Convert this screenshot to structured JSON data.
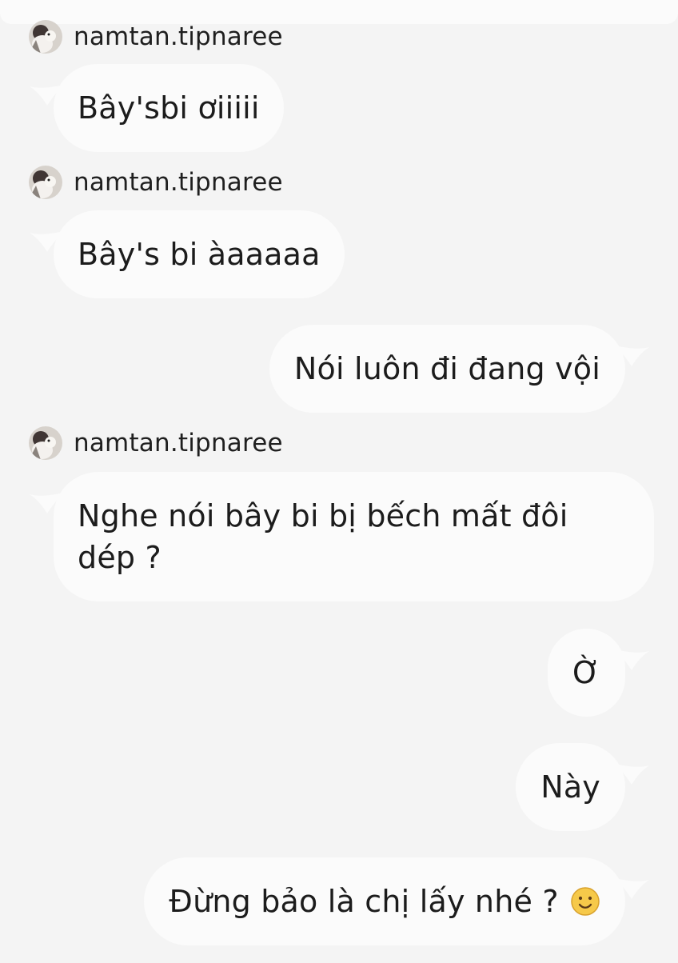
{
  "conversation": {
    "messages": [
      {
        "side": "left",
        "sender": "namtan.tipnaree",
        "text": "Bây'sbi ơiiiii"
      },
      {
        "side": "left",
        "sender": "namtan.tipnaree",
        "text": "Bây's bi àaaaaa"
      },
      {
        "side": "right",
        "text": "Nói luôn đi đang vội"
      },
      {
        "side": "left",
        "sender": "namtan.tipnaree",
        "text": "Nghe nói bây bi bị bếch mất đôi dép ?"
      },
      {
        "side": "right",
        "text": "Ờ"
      },
      {
        "side": "right",
        "text": "Này"
      },
      {
        "side": "right",
        "text": "Đừng bảo là chị lấy nhé ?",
        "emoji": "slightly-smiling-face-icon"
      }
    ]
  },
  "colors": {
    "background": "#f4f4f4",
    "bubble": "#fbfbfb",
    "text": "#1c1c1c",
    "emoji_fill": "#f6c94a"
  }
}
